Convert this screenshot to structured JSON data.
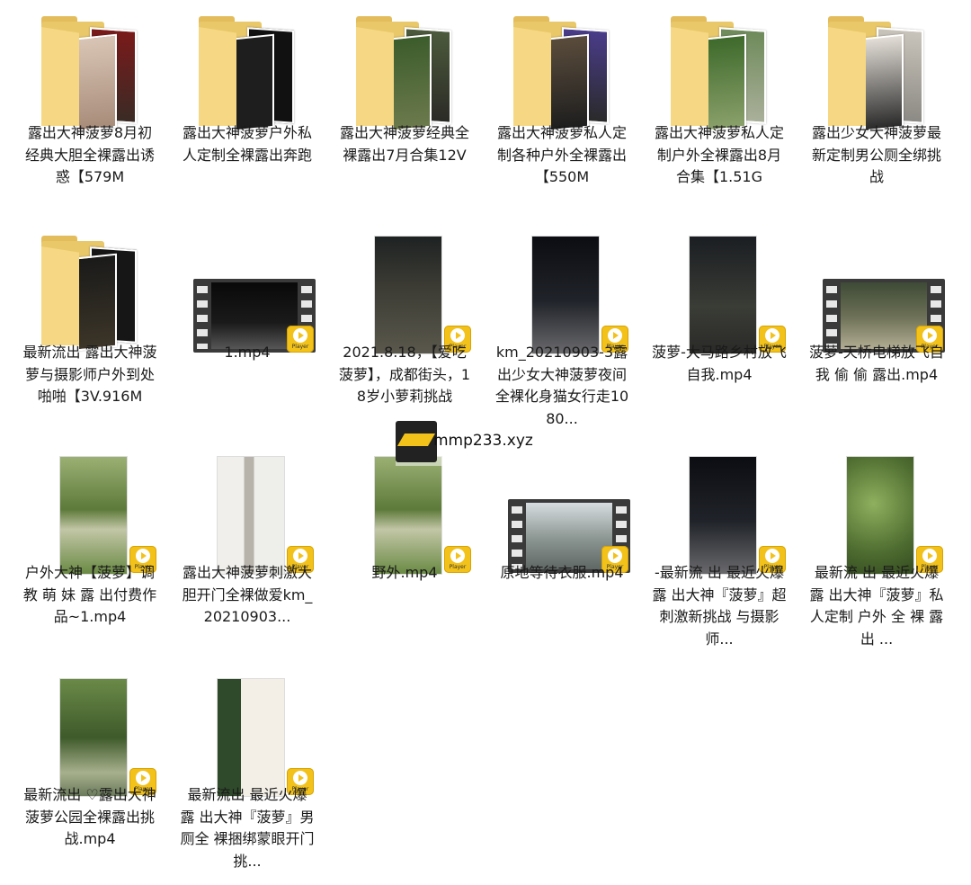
{
  "badge_text": "Player",
  "watermark": "mmp233.xyz",
  "items": [
    {
      "name": "露出大神菠萝8月初经典大胆全裸露出诱惑【579M"
    },
    {
      "name": "露出大神菠萝户外私人定制全裸露出奔跑"
    },
    {
      "name": "露出大神菠萝经典全裸露出7月合集12V"
    },
    {
      "name": "露出大神菠萝私人定制各种户外全裸露出【550M"
    },
    {
      "name": "露出大神菠萝私人定制户外全裸露出8月合集【1.51G"
    },
    {
      "name": "露出少女大神菠萝最新定制男公厕全绑挑战"
    },
    {
      "name": "最新流出 露出大神菠萝与摄影师户外到处啪啪【3V.916M"
    },
    {
      "name": "1.mp4"
    },
    {
      "name": "2021.8.18，【爱吃菠萝】，成都街头，18岁小萝莉挑战"
    },
    {
      "name": "km_20210903-3露出少女大神菠萝夜间全裸化身猫女行走1080..."
    },
    {
      "name": "菠萝-大马路乡村放飞自我.mp4"
    },
    {
      "name": "菠萝-天桥电梯放飞自我 偷 偷 露出.mp4"
    },
    {
      "name": "户外大神【菠萝】调 教 萌 妹 露 出付费作品~1.mp4"
    },
    {
      "name": "露出大神菠萝刺激大胆开门全裸做爱km_20210903..."
    },
    {
      "name": "野外.mp4"
    },
    {
      "name": "原地等待衣服.mp4"
    },
    {
      "name": "-最新流 出 最近火爆露 出大神『菠萝』超刺激新挑战 与摄影师..."
    },
    {
      "name": "最新流 出 最近火爆露 出大神『菠萝』私人定制 户外 全 裸 露 出 ..."
    },
    {
      "name": "最新流出 ♡露出大神菠萝公园全裸露出挑战.mp4"
    },
    {
      "name": "最新流出 最近火爆 露 出大神『菠萝』男厕全 裸捆绑蒙眼开门挑..."
    }
  ]
}
